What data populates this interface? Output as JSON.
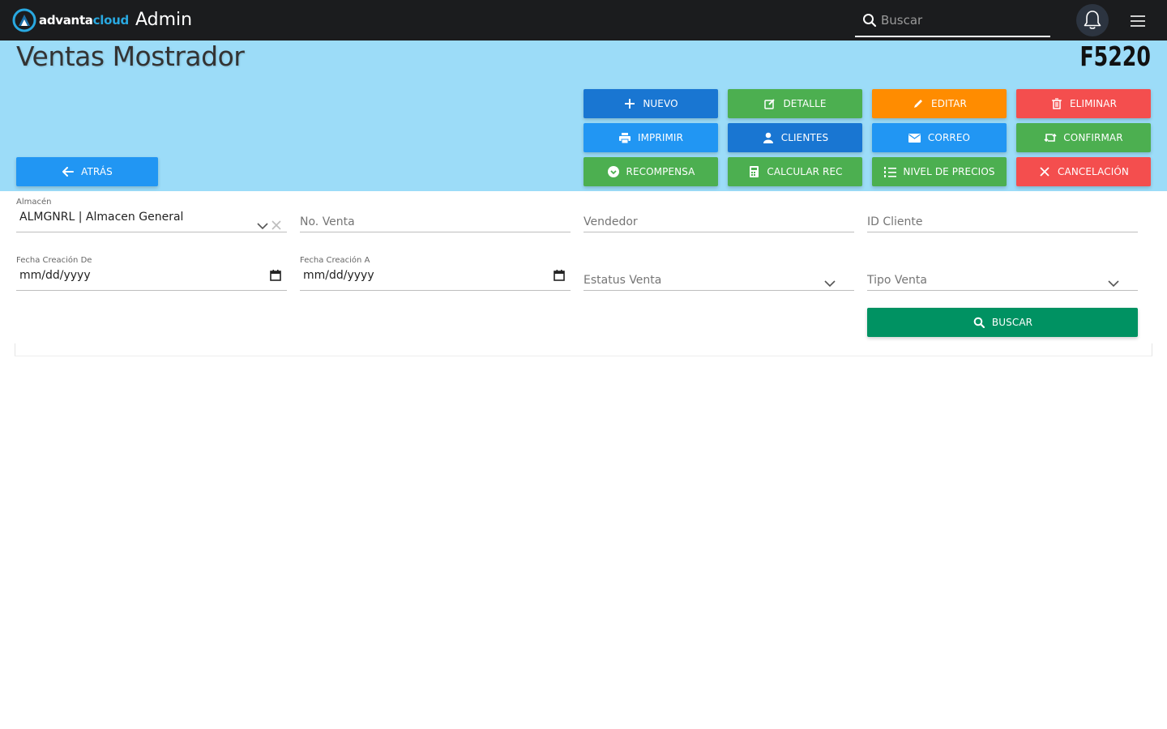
{
  "topbar": {
    "logo_text_main": "advanta",
    "logo_text_accent": "cloud",
    "app_title": "Admin",
    "search_placeholder": "Buscar",
    "icons": {
      "search": "search-icon",
      "bell": "bell-icon",
      "menu": "hamburger-menu-icon"
    }
  },
  "header": {
    "title": "Ventas Mostrador",
    "code": "F5220",
    "background": "#9cdcf8"
  },
  "buttons": {
    "back": {
      "label": "ATRÁS",
      "icon": "arrow-left-icon",
      "color": "#2196f3"
    },
    "actions": [
      {
        "label": "NUEVO",
        "icon": "plus-icon",
        "color": "#1976d2"
      },
      {
        "label": "DETALLE",
        "icon": "edit-box-icon",
        "color": "#4caf50"
      },
      {
        "label": "EDITAR",
        "icon": "pencil-icon",
        "color": "#ff8c00"
      },
      {
        "label": "ELIMINAR",
        "icon": "trash-icon",
        "color": "#f44e4e"
      },
      {
        "label": "IMPRIMIR",
        "icon": "printer-icon",
        "color": "#2196f3"
      },
      {
        "label": "CLIENTES",
        "icon": "user-icon",
        "color": "#1976d2"
      },
      {
        "label": "CORREO",
        "icon": "envelope-icon",
        "color": "#2196f3"
      },
      {
        "label": "CONFIRMAR",
        "icon": "retweet-icon",
        "color": "#4caf50"
      },
      {
        "label": "RECOMPENSA",
        "icon": "chevron-circle-icon",
        "color": "#4caf50"
      },
      {
        "label": "CALCULAR REC",
        "icon": "calculator-icon",
        "color": "#4caf50"
      },
      {
        "label": "NIVEL DE PRECIOS",
        "icon": "ordered-list-icon",
        "color": "#4caf50"
      },
      {
        "label": "CANCELACIÓN",
        "icon": "x-icon",
        "color": "#f44e4e"
      }
    ],
    "search": {
      "label": "BUSCAR",
      "icon": "search-icon",
      "color": "#009262"
    }
  },
  "filters": {
    "almacen": {
      "label": "Almacén",
      "value": "ALMGNRL | Almacen General"
    },
    "no_venta": {
      "placeholder": "No. Venta"
    },
    "vendedor": {
      "placeholder": "Vendedor"
    },
    "id_cliente": {
      "placeholder": "ID Cliente"
    },
    "fecha_de": {
      "label": "Fecha Creación De",
      "value": "mm/dd/yyyy"
    },
    "fecha_a": {
      "label": "Fecha Creación A",
      "value": "mm/dd/yyyy"
    },
    "estatus_venta": {
      "placeholder": "Estatus Venta"
    },
    "tipo_venta": {
      "placeholder": "Tipo Venta"
    }
  }
}
